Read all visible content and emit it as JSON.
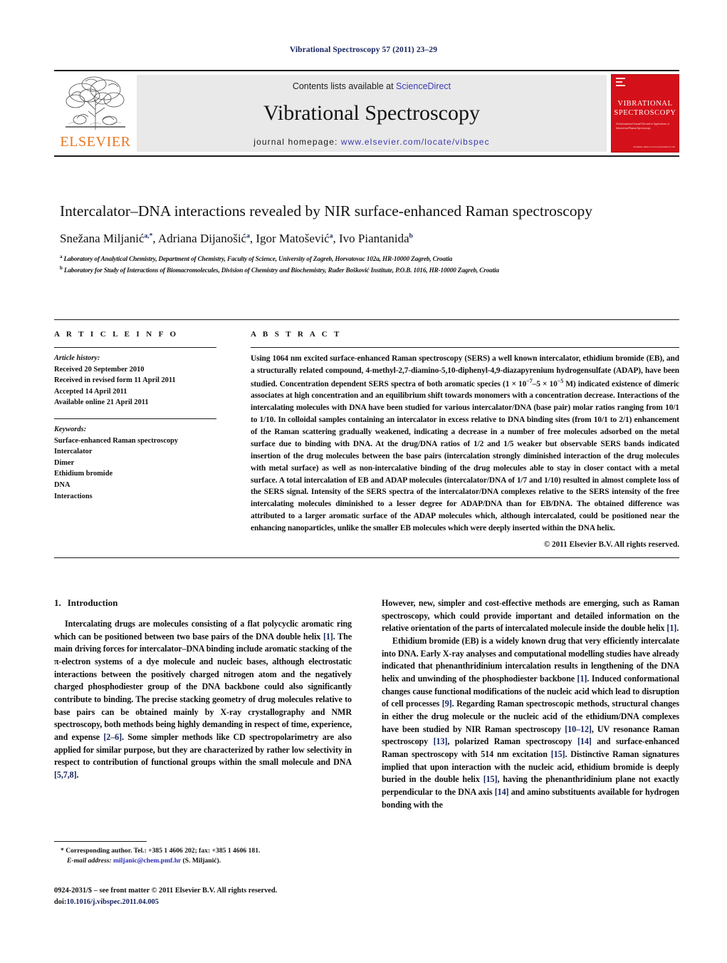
{
  "running_head": "Vibrational Spectroscopy 57 (2011) 23–29",
  "masthead": {
    "publisher_name": "ELSEVIER",
    "contents_prefix": "Contents lists available at ",
    "contents_link": "ScienceDirect",
    "journal_name": "Vibrational Spectroscopy",
    "homepage_prefix": "journal homepage: ",
    "homepage_url": "www.elsevier.com/locate/vibspec",
    "cover_title_line1": "VIBRATIONAL",
    "cover_title_line2": "SPECTROSCOPY",
    "cover_subtitle": "An International Journal Devoted to Applications of Infrared and Raman Spectroscopy",
    "cover_footer": "Available online at www.sciencedirect.com"
  },
  "article": {
    "title": "Intercalator–DNA interactions revealed by NIR surface-enhanced Raman spectroscopy",
    "authors": [
      {
        "name": "Snežana Miljanić",
        "marks": "a,*"
      },
      {
        "name": "Adriana Dijanošić",
        "marks": "a"
      },
      {
        "name": "Igor Matošević",
        "marks": "a"
      },
      {
        "name": "Ivo Piantanida",
        "marks": "b"
      }
    ],
    "affiliations": [
      {
        "mark": "a",
        "text": "Laboratory of Analytical Chemistry, Department of Chemistry, Faculty of Science, University of Zagreb, Horvatovac 102a, HR-10000 Zagreb, Croatia"
      },
      {
        "mark": "b",
        "text": "Laboratory for Study of Interactions of Biomacromolecules, Division of Chemistry and Biochemistry, Ruđer Bošković Institute, P.O.B. 1016, HR-10000 Zagreb, Croatia"
      }
    ]
  },
  "article_info": {
    "heading": "A R T I C L E    I N F O",
    "history_label": "Article history:",
    "history": [
      "Received 20 September 2010",
      "Received in revised form 11 April 2011",
      "Accepted 14 April 2011",
      "Available online 21 April 2011"
    ],
    "keywords_label": "Keywords:",
    "keywords": [
      "Surface-enhanced Raman spectroscopy",
      "Intercalator",
      "Dimer",
      "Ethidium bromide",
      "DNA",
      "Interactions"
    ]
  },
  "abstract": {
    "heading": "A B S T R A C T",
    "part1": "Using 1064 nm excited surface-enhanced Raman spectroscopy (SERS) a well known intercalator, ethidium bromide (EB), and a structurally related compound, 4-methyl-2,7-diamino-5,10-diphenyl-4,9-diazapyrenium hydrogensulfate (ADAP), have been studied. Concentration dependent SERS spectra of both aromatic species (1 × 10",
    "sup1": "−7",
    "part2": "–5 × 10",
    "sup2": "−5",
    "part3": " M) indicated existence of dimeric associates at high concentration and an equilibrium shift towards monomers with a concentration decrease. Interactions of the intercalating molecules with DNA have been studied for various intercalator/DNA (base pair) molar ratios ranging from 10/1 to 1/10. In colloidal samples containing an intercalator in excess relative to DNA binding sites (from 10/1 to 2/1) enhancement of the Raman scattering gradually weakened, indicating a decrease in a number of free molecules adsorbed on the metal surface due to binding with DNA. At the drug/DNA ratios of 1/2 and 1/5 weaker but observable SERS bands indicated insertion of the drug molecules between the base pairs (intercalation strongly diminished interaction of the drug molecules with metal surface) as well as non-intercalative binding of the drug molecules able to stay in closer contact with a metal surface. A total intercalation of EB and ADAP molecules (intercalator/DNA of 1/7 and 1/10) resulted in almost complete loss of the SERS signal. Intensity of the SERS spectra of the intercalator/DNA complexes relative to the SERS intensity of the free intercalating molecules diminished to a lesser degree for ADAP/DNA than for EB/DNA. The obtained difference was attributed to a larger aromatic surface of the ADAP molecules which, although intercalated, could be positioned near the enhancing nanoparticles, unlike the smaller EB molecules which were deeply inserted within the DNA helix.",
    "copyright": "© 2011 Elsevier B.V. All rights reserved."
  },
  "introduction": {
    "number": "1.",
    "title": "Introduction",
    "left_para_1_a": "Intercalating drugs are molecules consisting of a flat polycyclic aromatic ring which can be positioned between two base pairs of the DNA double helix ",
    "left_ref_1": "[1]",
    "left_para_1_b": ". The main driving forces for intercalator–DNA binding include aromatic stacking of the π-electron systems of a dye molecule and nucleic bases, although electrostatic interactions between the positively charged nitrogen atom and the negatively charged phosphodiester group of the DNA backbone could also significantly contribute to binding. The precise stacking geometry of drug molecules relative to base pairs can be obtained mainly by X-ray crystallography and NMR spectroscopy, both methods being highly demanding in respect of time, experience, and expense ",
    "left_ref_2": "[2–6]",
    "left_para_1_c": ". Some simpler methods like CD spectropolarimetry are also applied for similar purpose, but they are characterized by rather low selectivity in respect to contribution of functional groups within the small molecule and DNA ",
    "left_ref_3": "[5,7,8]",
    "left_para_1_d": ".",
    "right_para_1_a": "However, new, simpler and cost-effective methods are emerging, such as Raman spectroscopy, which could provide important and detailed information on the relative orientation of the parts of intercalated molecule inside the double helix ",
    "right_ref_1": "[1]",
    "right_para_1_b": ".",
    "right_para_2_a": "Ethidium bromide (EB) is a widely known drug that very efficiently intercalate into DNA. Early X-ray analyses and computational modelling studies have already indicated that phenanthridinium intercalation results in lengthening of the DNA helix and unwinding of the phosphodiester backbone ",
    "right_ref_2": "[1]",
    "right_para_2_b": ". Induced conformational changes cause functional modifications of the nucleic acid which lead to disruption of cell processes ",
    "right_ref_3": "[9]",
    "right_para_2_c": ". Regarding Raman spectroscopic methods, structural changes in either the drug molecule or the nucleic acid of the ethidium/DNA complexes have been studied by NIR Raman spectroscopy ",
    "right_ref_4": "[10–12]",
    "right_para_2_d": ", UV resonance Raman spectroscopy ",
    "right_ref_5": "[13]",
    "right_para_2_e": ", polarized Raman spectroscopy ",
    "right_ref_6": "[14]",
    "right_para_2_f": " and surface-enhanced Raman spectroscopy with 514 nm excitation ",
    "right_ref_7": "[15]",
    "right_para_2_g": ". Distinctive Raman signatures implied that upon interaction with the nucleic acid, ethidium bromide is deeply buried in the double helix ",
    "right_ref_8": "[15]",
    "right_para_2_h": ", having the phenanthridinium plane not exactly perpendicular to the DNA axis ",
    "right_ref_9": "[14]",
    "right_para_2_i": " and amino substituents available for hydrogen bonding with the"
  },
  "footnote": {
    "marker": "*",
    "text_a": "Corresponding author. Tel.: +385 1 4606 202; fax: +385 1 4606 181.",
    "email_label": "E-mail address:",
    "email": "miljanic@chem.pmf.hr",
    "email_suffix": "(S. Miljanić)."
  },
  "footer": {
    "issn_line": "0924-2031/$ – see front matter © 2011 Elsevier B.V. All rights reserved.",
    "doi_label": "doi:",
    "doi_value": "10.1016/j.vibspec.2011.04.005"
  },
  "colors": {
    "link_blue": "#3b3bb0",
    "ref_navy": "#14225c",
    "elsevier_orange": "#e87722",
    "cover_red": "#d4111a"
  }
}
